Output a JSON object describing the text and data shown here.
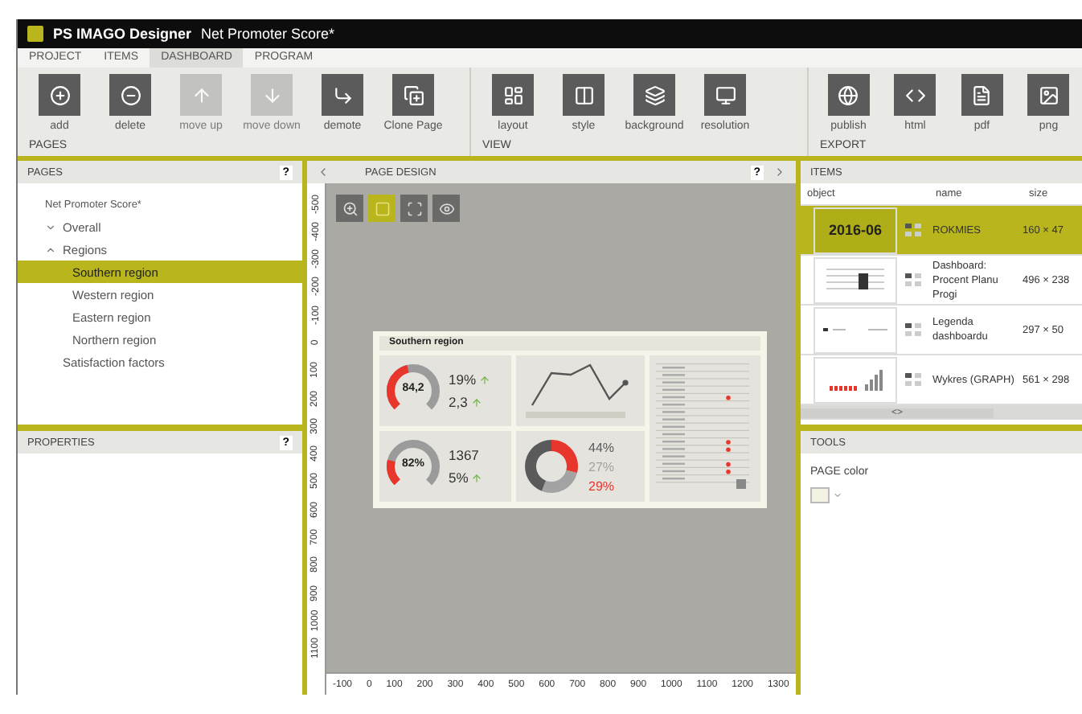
{
  "window": {
    "title": "PS IMAGO Designer",
    "document": "Net Promoter Score*"
  },
  "ribbon_tabs": [
    {
      "label": "PROJECT",
      "selected": false
    },
    {
      "label": "ITEMS",
      "selected": false
    },
    {
      "label": "DASHBOARD",
      "selected": true
    },
    {
      "label": "PROGRAM",
      "selected": false
    }
  ],
  "ribbon_groups": [
    {
      "label": "PAGES",
      "buttons": [
        {
          "kind": "add",
          "label": "add",
          "disabled": false
        },
        {
          "kind": "delete",
          "label": "delete",
          "disabled": false
        },
        {
          "kind": "move_up",
          "label": "move up",
          "disabled": true
        },
        {
          "kind": "move_down",
          "label": "move down",
          "disabled": true
        },
        {
          "kind": "demote",
          "label": "demote",
          "disabled": false
        },
        {
          "kind": "clone",
          "label": "Clone Page",
          "disabled": false
        }
      ]
    },
    {
      "label": "VIEW",
      "buttons": [
        {
          "kind": "layout",
          "label": "layout",
          "disabled": false
        },
        {
          "kind": "style",
          "label": "style",
          "disabled": false
        },
        {
          "kind": "background",
          "label": "background",
          "disabled": false
        },
        {
          "kind": "resolution",
          "label": "resolution",
          "disabled": false
        }
      ]
    },
    {
      "label": "EXPORT",
      "buttons": [
        {
          "kind": "publish",
          "label": "publish",
          "disabled": false
        },
        {
          "kind": "html",
          "label": "html",
          "disabled": false
        },
        {
          "kind": "pdf",
          "label": "pdf",
          "disabled": false
        },
        {
          "kind": "png",
          "label": "png",
          "disabled": false
        }
      ]
    }
  ],
  "pages_panel": {
    "title": "PAGES",
    "help": "?",
    "tree": [
      {
        "label": "Net Promoter Score*",
        "selected": false,
        "children": [
          {
            "label": "Overall",
            "selected": false,
            "expanded": false
          },
          {
            "label": "Regions",
            "selected": false,
            "expanded": true,
            "children": [
              {
                "label": "Southern region",
                "selected": true
              },
              {
                "label": "Western region",
                "selected": false
              },
              {
                "label": "Eastern region",
                "selected": false
              },
              {
                "label": "Northern region",
                "selected": false
              }
            ]
          },
          {
            "label": "Satisfaction factors",
            "selected": false
          }
        ]
      }
    ]
  },
  "properties_panel": {
    "title": "PROPERTIES",
    "help": "?"
  },
  "page_design": {
    "title": "PAGE DESIGN",
    "help": "?",
    "tools": [
      {
        "kind": "zoom",
        "selected": false
      },
      {
        "kind": "fill",
        "selected": true
      },
      {
        "kind": "fit",
        "selected": false
      },
      {
        "kind": "preview",
        "selected": false
      }
    ],
    "vertical_ruler": [
      "-500",
      "-400",
      "-300",
      "-200",
      "-100",
      "0",
      "100",
      "200",
      "300",
      "400",
      "500",
      "600",
      "700",
      "800",
      "900",
      "1000",
      "1100"
    ],
    "horizontal_ruler": [
      "-100",
      "0",
      "100",
      "200",
      "300",
      "400",
      "500",
      "600",
      "700",
      "800",
      "900",
      "1000",
      "1100",
      "1200",
      "1300"
    ],
    "preview": {
      "title": "Southern region",
      "gauges": [
        {
          "value": "84,2",
          "level": 0.45,
          "stats": [
            {
              "value": "19%",
              "up": true
            },
            {
              "value": "2,3",
              "up": true
            }
          ]
        },
        {
          "value": "82%",
          "level": 0.22,
          "stats": [
            {
              "value": "1367",
              "up": false
            },
            {
              "value": "5%",
              "up": true
            }
          ]
        }
      ],
      "shares": [
        {
          "value": "44%",
          "color": "#5a5a5a"
        },
        {
          "value": "27%",
          "color": "#a3a3a3"
        },
        {
          "value": "29%",
          "color": "#e8362c"
        }
      ],
      "chart_data": {
        "type": "donut",
        "values": [
          44,
          27,
          29
        ]
      }
    }
  },
  "items_panel": {
    "title": "ITEMS",
    "columns": [
      "object",
      "name",
      "size"
    ],
    "rows": [
      {
        "kind": "text",
        "object_text": "2016-06",
        "name": "ROKMIES",
        "size": "160 × 47",
        "selected": true
      },
      {
        "kind": "table",
        "name": "Dashboard: Procent Planu Progi",
        "size": "496 × 238",
        "selected": false
      },
      {
        "kind": "legend",
        "name": "Legenda dashboardu",
        "size": "297 × 50",
        "selected": false
      },
      {
        "kind": "bar_chart",
        "name": "Wykres (GRAPH)",
        "size": "561 × 298",
        "selected": false
      }
    ],
    "scroll_label": "<>"
  },
  "tools_panel": {
    "title": "TOOLS",
    "page_color_label": "PAGE color"
  }
}
